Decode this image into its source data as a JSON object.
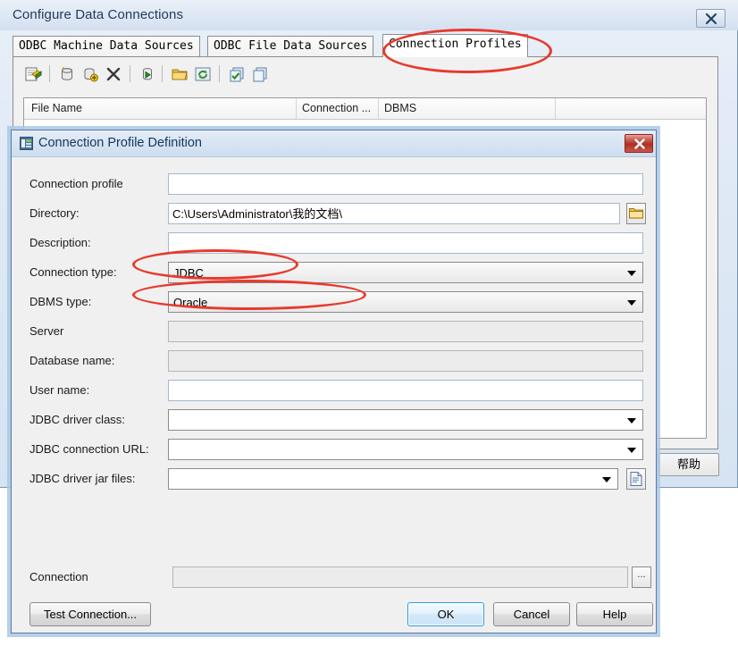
{
  "outer_window": {
    "title": "Configure Data Connections",
    "close_icon": "close-icon",
    "tabs": [
      {
        "label": "ODBC Machine Data Sources",
        "selected": false
      },
      {
        "label": "ODBC File Data Sources",
        "selected": false
      },
      {
        "label": "Connection Profiles",
        "selected": true
      }
    ],
    "toolbar_icons": [
      "new-profile-icon",
      "new-database-icon",
      "add-database-icon",
      "delete-icon",
      "run-icon",
      "open-folder-icon",
      "refresh-icon",
      "check-copy-icon",
      "copy-icon"
    ],
    "grid": {
      "columns": [
        "File Name",
        "Connection ...",
        "DBMS",
        ""
      ],
      "rows": []
    },
    "help_button": "帮助"
  },
  "dialog": {
    "title": "Connection Profile Definition",
    "title_icon": "window-icon",
    "close_icon": "close-icon",
    "fields": [
      {
        "label": "Connection profile",
        "value": "",
        "type": "text",
        "enabled": true
      },
      {
        "label": "Directory:",
        "value": "C:\\Users\\Administrator\\我的文档\\",
        "type": "text-with-browse",
        "enabled": true,
        "browse_icon": "folder-icon"
      },
      {
        "label": "Description:",
        "value": "",
        "type": "text",
        "enabled": true
      },
      {
        "label": "Connection type:",
        "value": "JDBC",
        "type": "combo",
        "enabled": true
      },
      {
        "label": "DBMS type:",
        "value": "Oracle",
        "type": "combo",
        "enabled": true
      },
      {
        "label": "Server",
        "value": "",
        "type": "text",
        "enabled": false
      },
      {
        "label": "Database name:",
        "value": "",
        "type": "text",
        "enabled": false
      },
      {
        "label": "User name:",
        "value": "",
        "type": "text",
        "enabled": true
      },
      {
        "label": "JDBC driver class:",
        "value": "",
        "type": "combo-white",
        "enabled": true
      },
      {
        "label": "JDBC connection URL:",
        "value": "",
        "type": "combo-white",
        "enabled": true
      },
      {
        "label": "JDBC driver jar files:",
        "value": "",
        "type": "combo-with-browse",
        "enabled": true,
        "browse_icon": "file-icon"
      }
    ],
    "connection": {
      "label": "Connection",
      "value": "",
      "browse_label": "..."
    },
    "buttons": {
      "test_connection": "Test Connection...",
      "ok": "OK",
      "cancel": "Cancel",
      "help": "Help"
    }
  },
  "annotations": {
    "accent_color": "#e8392c",
    "marks": [
      {
        "name": "annotation-connection-profiles-tab",
        "target": "Connection Profiles"
      },
      {
        "name": "annotation-connection-type",
        "target": "JDBC"
      },
      {
        "name": "annotation-dbms-type",
        "target": "Oracle"
      }
    ]
  }
}
